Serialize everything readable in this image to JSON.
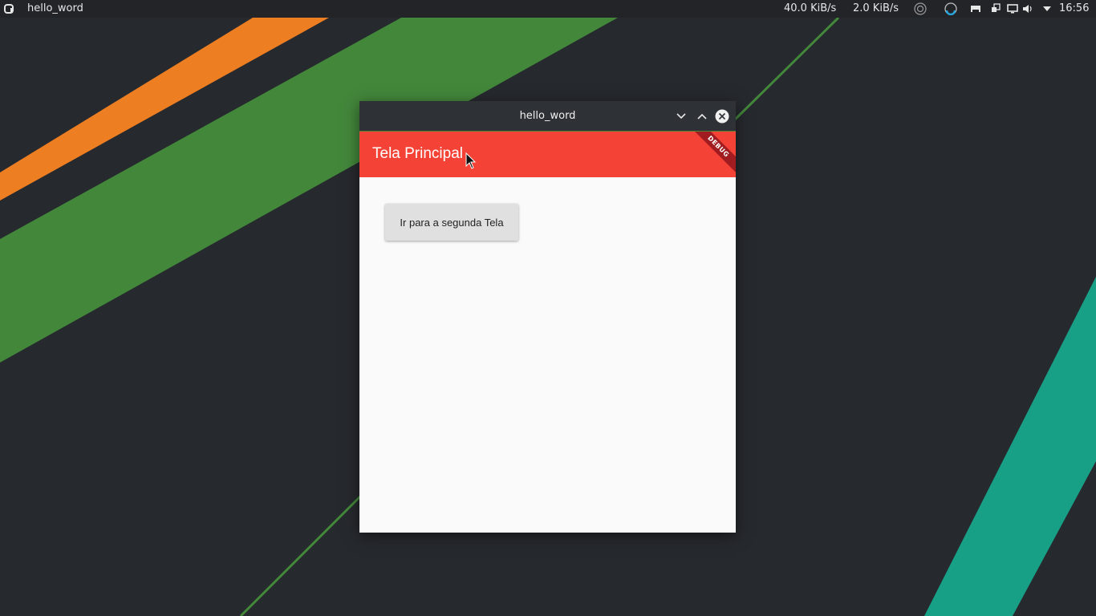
{
  "colors": {
    "orange_stripe": "#ee7e22",
    "green_stripe": "#43873b",
    "teal_stripe": "#17a086",
    "appbar": "#f44336",
    "debug_banner": "#a01c20",
    "titlebar": "#2e3136",
    "panel": "#222427"
  },
  "top_panel": {
    "launcher_icon": "a",
    "active_app": "hello_word",
    "net_down": "40.0 KiB/s",
    "net_up": "2.0 KiB/s",
    "clock": "16:56",
    "tray_icons": [
      "circle-status-icon",
      "blue-circle-icon",
      "printer-icon",
      "network-icon",
      "display-icon",
      "volume-icon",
      "dropdown-arrow-icon"
    ]
  },
  "window": {
    "title": "hello_word",
    "buttons": [
      "minimize",
      "maximize",
      "close"
    ]
  },
  "app": {
    "appbar_title": "Tela Principal",
    "debug_label": "DEBUG",
    "button_label": "Ir para a segunda Tela"
  }
}
